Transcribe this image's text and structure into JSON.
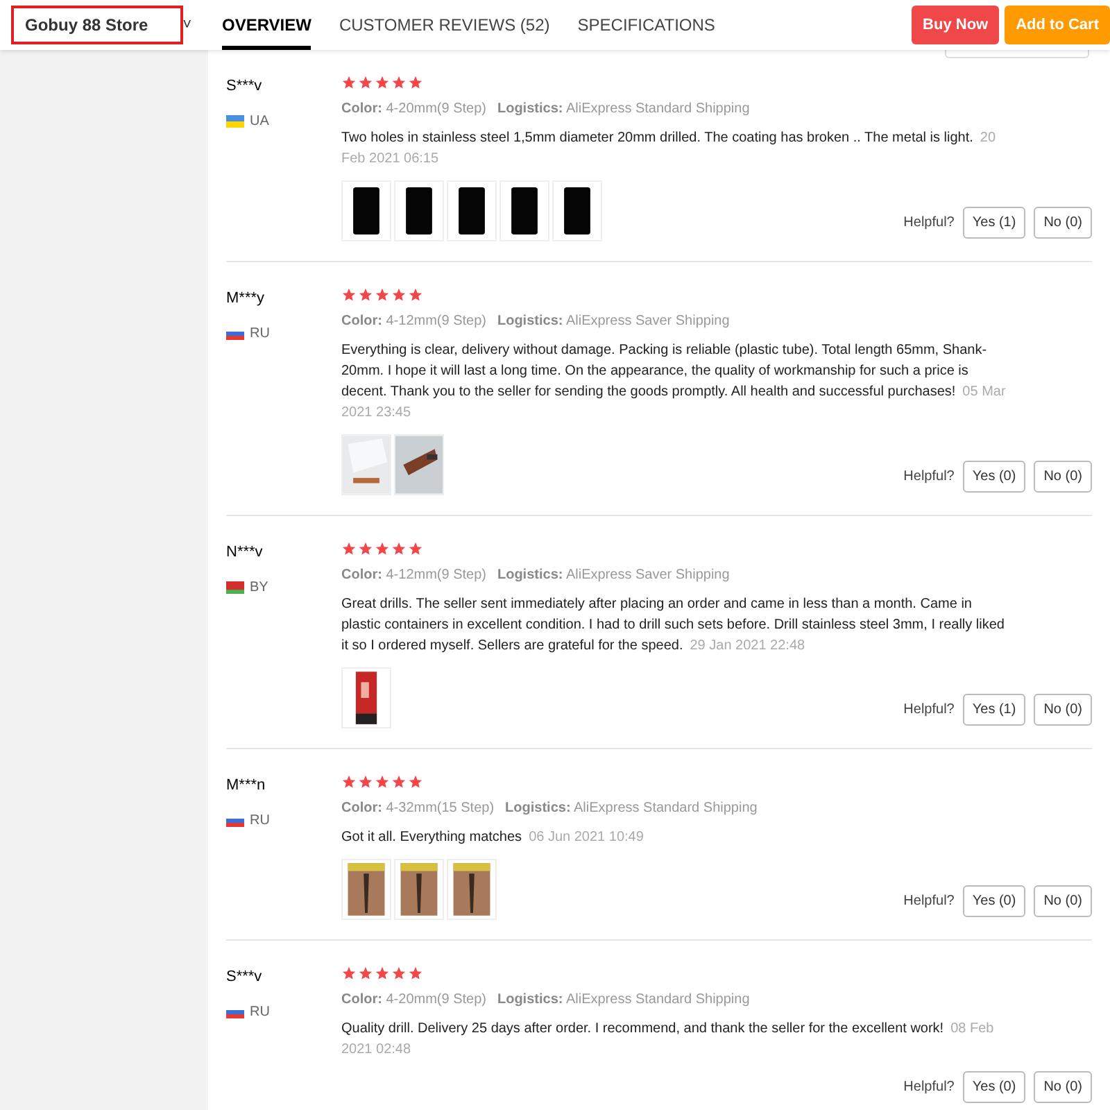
{
  "store": {
    "name": "Gobuy 88 Store",
    "caret": "˅"
  },
  "tabs": [
    {
      "label": "OVERVIEW",
      "selected": true
    },
    {
      "label": "CUSTOMER REVIEWS (52)",
      "selected": false
    },
    {
      "label": "SPECIFICATIONS",
      "selected": false
    }
  ],
  "actions": [
    {
      "label": "Buy Now",
      "kind": "buy"
    },
    {
      "label": "Add to Cart",
      "kind": "cart"
    }
  ],
  "reviews": [
    {
      "name": "S***v",
      "country": "UA",
      "flag_stripes": [
        {
          "color": "#4a90e2"
        },
        {
          "color": "#ffd500"
        }
      ],
      "stars": 5,
      "color_label": "Color:",
      "color_value": "4-20mm(9 Step)",
      "logistics_label": "Logistics:",
      "logistics_value": "AliExpress Standard Shipping",
      "text": "Two holes in stainless steel 1,5mm diameter 20mm drilled. The coating has broken .. The metal is light.",
      "date": "20 Feb 2021 06:15",
      "photos": [
        {
          "kind": "dark"
        },
        {
          "kind": "dark"
        },
        {
          "kind": "dark"
        },
        {
          "kind": "dark"
        },
        {
          "kind": "dark"
        }
      ],
      "helpful": "Helpful?",
      "yes": "Yes (1)",
      "no": "No (0)"
    },
    {
      "name": "M***y",
      "country": "RU",
      "flag_stripes": [
        {
          "color": "#ffffff"
        },
        {
          "color": "#3a6fd8"
        },
        {
          "color": "#e53935"
        }
      ],
      "stars": 5,
      "color_label": "Color:",
      "color_value": "4-12mm(9 Step)",
      "logistics_label": "Logistics:",
      "logistics_value": "AliExpress Saver Shipping",
      "text": "Everything is clear, delivery without damage. Packing is reliable (plastic tube). Total length 65mm, Shank-20mm. I hope it will last a long time. On the appearance, the quality of workmanship for such a price is decent. Thank you to the seller for sending the goods promptly. All health and successful purchases!",
      "date": "05 Mar 2021 23:45",
      "photos": [
        {
          "kind": "light"
        },
        {
          "kind": "grey"
        }
      ],
      "helpful": "Helpful?",
      "yes": "Yes (0)",
      "no": "No (0)"
    },
    {
      "name": "N***v",
      "country": "BY",
      "flag_stripes": [
        {
          "color": "#d32f2f"
        },
        {
          "color": "#d32f2f"
        },
        {
          "color": "#4caf50"
        }
      ],
      "stars": 5,
      "color_label": "Color:",
      "color_value": "4-12mm(9 Step)",
      "logistics_label": "Logistics:",
      "logistics_value": "AliExpress Saver Shipping",
      "text": "Great drills. The seller sent immediately after placing an order and came in less than a month. Came in plastic containers in excellent condition. I had to drill such sets before. Drill stainless steel 3mm, I really liked it so I ordered myself. Sellers are grateful for the speed.",
      "date": "29 Jan 2021 22:48",
      "photos": [
        {
          "kind": "red"
        }
      ],
      "helpful": "Helpful?",
      "yes": "Yes (1)",
      "no": "No (0)"
    },
    {
      "name": "M***n",
      "country": "RU",
      "flag_stripes": [
        {
          "color": "#ffffff"
        },
        {
          "color": "#3a6fd8"
        },
        {
          "color": "#e53935"
        }
      ],
      "stars": 5,
      "color_label": "Color:",
      "color_value": "4-32mm(15 Step)",
      "logistics_label": "Logistics:",
      "logistics_value": "AliExpress Standard Shipping",
      "text": "Got it all. Everything matches",
      "date": "06 Jun 2021 10:49",
      "photos": [
        {
          "kind": "brown"
        },
        {
          "kind": "brown"
        },
        {
          "kind": "brown"
        }
      ],
      "helpful": "Helpful?",
      "yes": "Yes (0)",
      "no": "No (0)"
    },
    {
      "name": "S***v",
      "country": "RU",
      "flag_stripes": [
        {
          "color": "#ffffff"
        },
        {
          "color": "#3a6fd8"
        },
        {
          "color": "#e53935"
        }
      ],
      "stars": 5,
      "color_label": "Color:",
      "color_value": "4-20mm(9 Step)",
      "logistics_label": "Logistics:",
      "logistics_value": "AliExpress Standard Shipping",
      "text": "Quality drill. Delivery 25 days after order. I recommend, and thank the seller for the excellent work!",
      "date": "08 Feb 2021 02:48",
      "helpful": "Helpful?",
      "yes": "Yes (0)",
      "no": "No (0)"
    }
  ]
}
